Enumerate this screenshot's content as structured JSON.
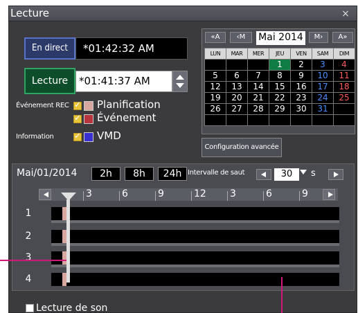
{
  "window": {
    "title": "Lecture",
    "close": "×"
  },
  "live": {
    "label": "En direct",
    "time": "*01:42:32 AM"
  },
  "playback": {
    "label": "Lecture",
    "time": "*01:41:37 AM"
  },
  "event_rec": {
    "label": "Événement REC",
    "items": [
      {
        "label": "Planification",
        "color": "#d8a7a0",
        "checked": true
      },
      {
        "label": "Événement",
        "color": "#b8343f",
        "checked": true
      }
    ]
  },
  "information": {
    "label": "Information",
    "items": [
      {
        "label": "VMD",
        "color": "#3a2fd0",
        "checked": true
      }
    ]
  },
  "calendar": {
    "nav": [
      "«A",
      "‹M",
      "M›",
      "A»"
    ],
    "month": "Mai 2014",
    "headers": [
      "LUN",
      "MAR",
      "MER",
      "JEU",
      "VEN",
      "SAM",
      "DIM"
    ],
    "weeks": [
      [
        "",
        "",
        "",
        "1",
        "2",
        "3",
        "4"
      ],
      [
        "5",
        "6",
        "7",
        "8",
        "9",
        "10",
        "11"
      ],
      [
        "12",
        "13",
        "14",
        "15",
        "16",
        "17",
        "18"
      ],
      [
        "19",
        "20",
        "21",
        "22",
        "23",
        "24",
        "25"
      ],
      [
        "26",
        "27",
        "28",
        "29",
        "30",
        "31",
        ""
      ],
      [
        "",
        "",
        "",
        "",
        "",
        "",
        ""
      ]
    ],
    "selected_day": "1"
  },
  "config_button": "Configuration avancée",
  "timeline": {
    "date": "Mai/01/2014",
    "zoom": [
      "2h",
      "8h",
      "24h"
    ],
    "skip_label": "Intervalle de saut",
    "skip_value": "30",
    "skip_unit": "s",
    "hours": [
      "3",
      "6",
      "9",
      "12",
      "3",
      "6",
      "9"
    ],
    "rows": [
      "1",
      "2",
      "3",
      "4"
    ]
  },
  "sound": {
    "label": "Lecture de son",
    "checked": false
  }
}
